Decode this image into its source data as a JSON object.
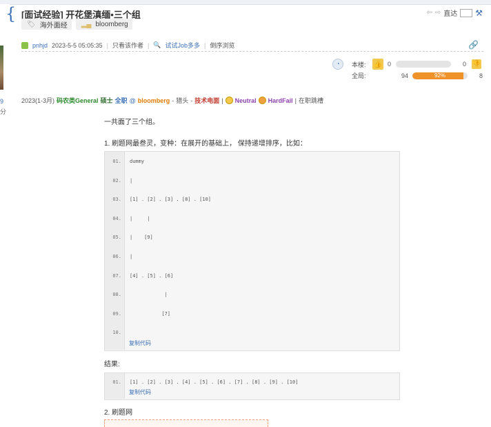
{
  "thread": {
    "title": "[面试经验] 开花堡滇缅•三个组",
    "tags": [
      {
        "label": "海外面经",
        "icon": "tag-icon"
      },
      {
        "label": "bloomberg",
        "icon": "signal-icon"
      }
    ],
    "tools": {
      "goto_label": "直达"
    }
  },
  "post_meta": {
    "author": "pnhjd",
    "datetime": "2023-5-5 05:05:35",
    "only_author": "只看该作者",
    "search_link": "试试Job多多",
    "reverse": "倒序浏览"
  },
  "votes": {
    "floor_label": "本楼:",
    "floor_up": "0",
    "floor_down": "0",
    "floor_fraction": 0,
    "global_label": "全局:",
    "global_up": "94",
    "global_down": "8",
    "global_pct_text": "92%",
    "global_fraction": 0.92
  },
  "info_line": {
    "date": "2023(1-3月)",
    "level": "码农类General",
    "degree": "硕士",
    "type": "全职",
    "at": "@",
    "company": "bloomberg",
    "sep1": "-",
    "stage": "猎头",
    "sep2": "-",
    "format": "技术电面",
    "sep3": "|",
    "result1": "Neutral",
    "result2": "HardFail",
    "sep4": "|",
    "status": "在职跳槽"
  },
  "body": {
    "p1": "一共面了三个组。",
    "p2": "1. 刷题网最叁灵，变种：在展开的基础上， 保持递增排序，比如：",
    "code1_lines": [
      {
        "n": "01.",
        "t": "dummy"
      },
      {
        "n": "02.",
        "t": "|"
      },
      {
        "n": "03.",
        "t": "[1] . [2] . [3] . [8] . [10]"
      },
      {
        "n": "04.",
        "t": "|     |"
      },
      {
        "n": "05.",
        "t": "|    [9]"
      },
      {
        "n": "06.",
        "t": "|"
      },
      {
        "n": "07.",
        "t": "[4] . [5] . [6]"
      },
      {
        "n": "08.",
        "t": "            |"
      },
      {
        "n": "09.",
        "t": "           [7]"
      },
      {
        "n": "10.",
        "t": ""
      }
    ],
    "copy_label": "复制代码",
    "p3": "结果:",
    "code2_lines": [
      {
        "n": "01.",
        "t": "[1] . [2] . [3] . [4] . [5] . [6] . [7] . [8] . [9] . [10]"
      }
    ],
    "p4": "2. 刷题网"
  },
  "left": {
    "num": "9",
    "num2": "分"
  }
}
